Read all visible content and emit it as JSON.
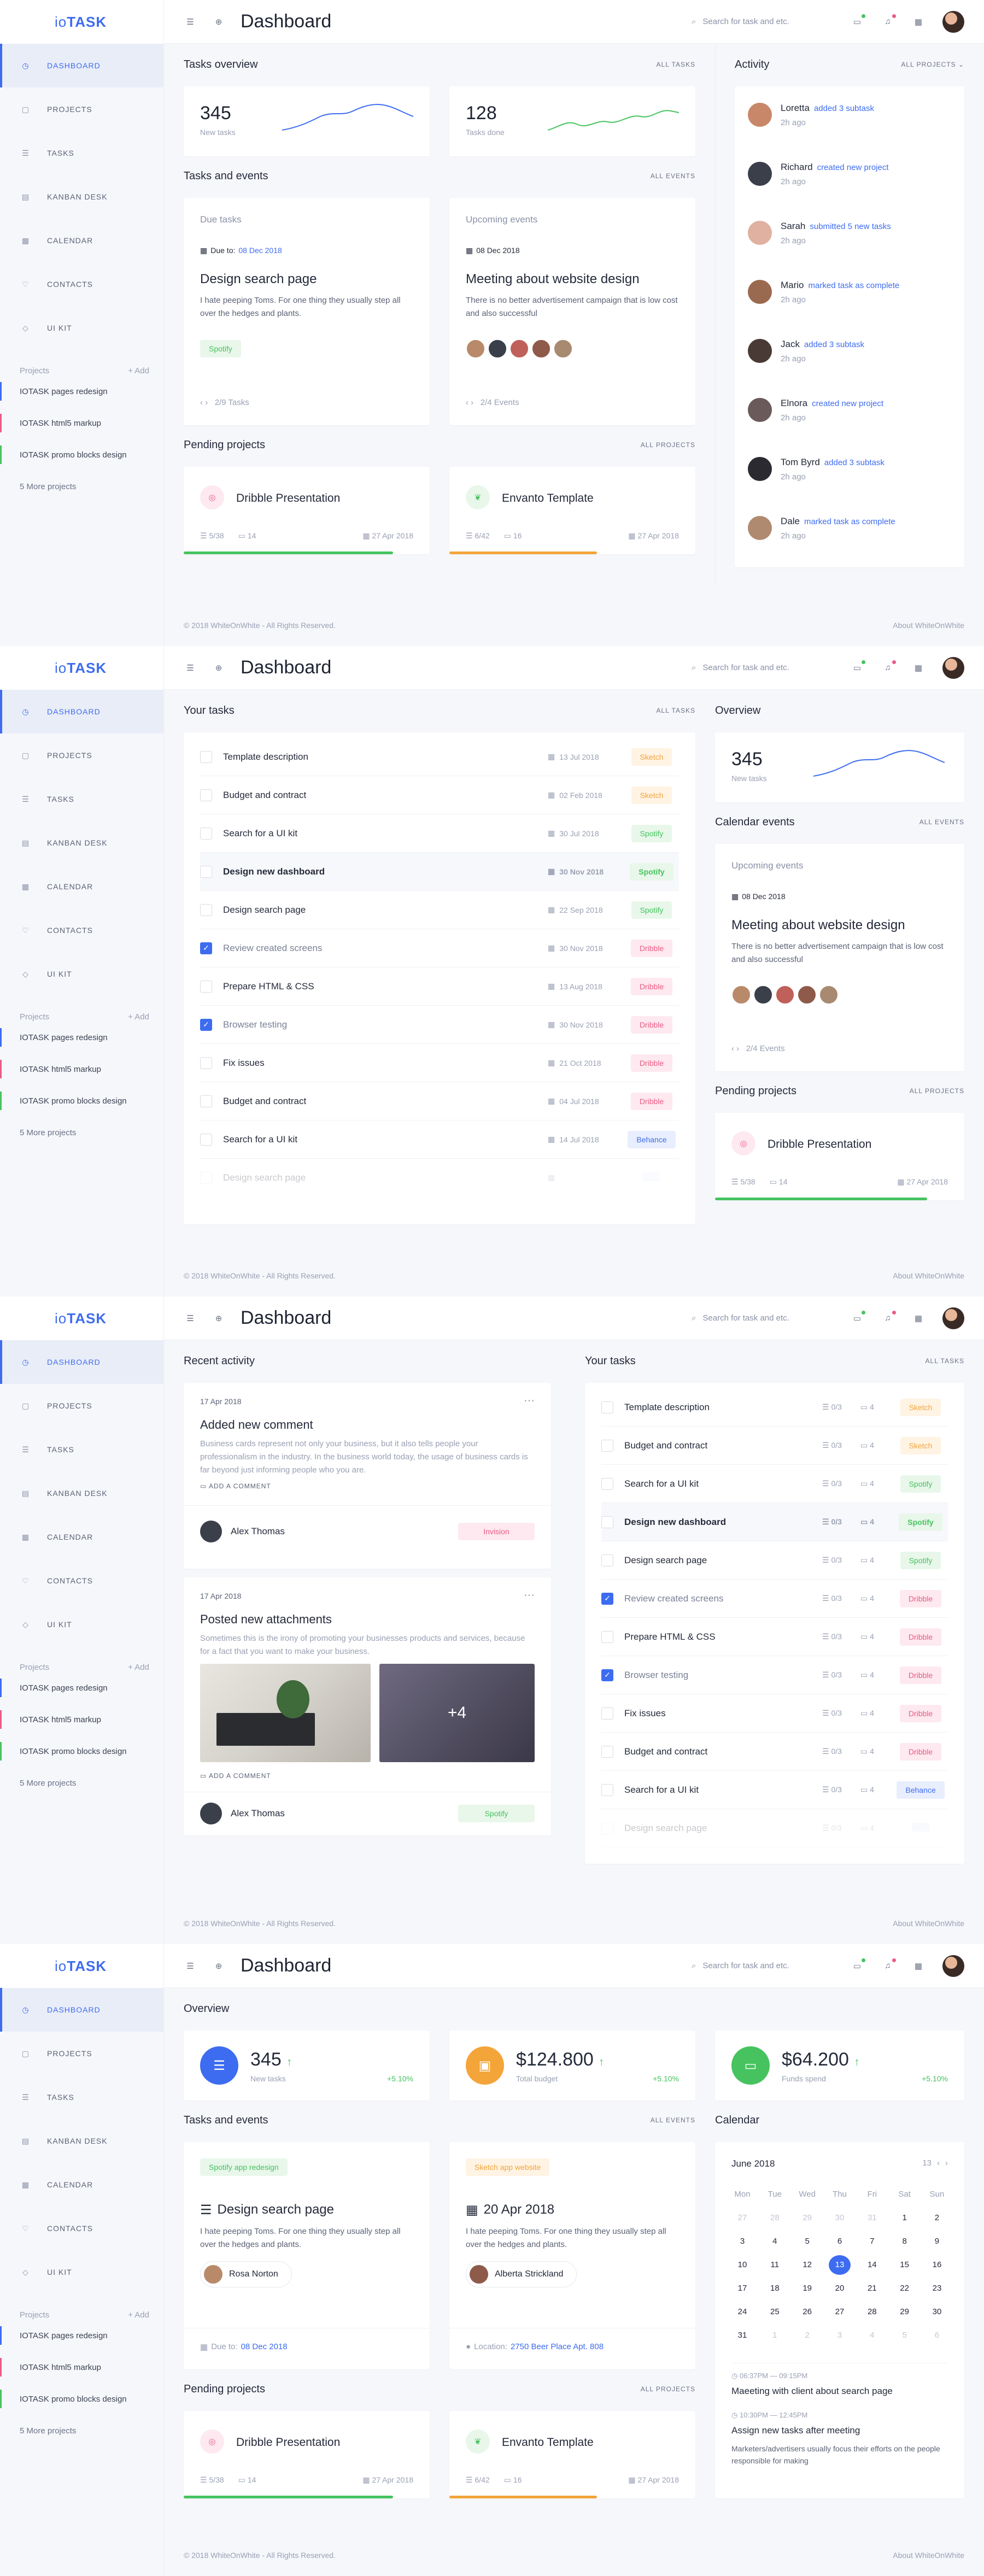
{
  "brand": {
    "prefix": "io",
    "name": "TASK"
  },
  "nav": [
    "DASHBOARD",
    "PROJECTS",
    "TASKS",
    "KANBAN DESK",
    "CALENDAR",
    "CONTACTS",
    "UI KIT"
  ],
  "projects_label": "Projects",
  "add_label": "Add",
  "projects": [
    {
      "name": "IOTASK pages redesign",
      "color": "#3d6cf0"
    },
    {
      "name": "IOTASK html5 markup",
      "color": "#ea5b86"
    },
    {
      "name": "IOTASK promo blocks design",
      "color": "#46c35f"
    }
  ],
  "more_projects": "5 More projects",
  "page_title": "Dashboard",
  "search_placeholder": "Search for task and etc.",
  "footer_left": "© 2018 WhiteOnWhite - All Rights Reserved.",
  "footer_right": "About WhiteOnWhite",
  "s1": {
    "tasks_overview": "Tasks overview",
    "all_tasks": "ALL TASKS",
    "new_tasks_num": "345",
    "new_tasks_label": "New tasks",
    "done_num": "128",
    "done_label": "Tasks done",
    "tasks_events": "Tasks and events",
    "all_events": "ALL EVENTS",
    "due_title": "Due tasks",
    "due_to": "Due to:",
    "due_date": "08 Dec 2018",
    "due_task": "Design search page",
    "due_desc": "I hate peeping Toms. For one thing they usually step all over the hedges and plants.",
    "due_tag": "Spotify",
    "due_pager": "2/9 Tasks",
    "up_title": "Upcoming events",
    "up_date": "08 Dec 2018",
    "up_event": "Meeting about website design",
    "up_desc": "There is no better advertisement campaign that is low cost and also successful",
    "up_pager": "2/4 Events",
    "pending": "Pending projects",
    "all_projects": "ALL PROJECTS",
    "p1_name": "Dribble Presentation",
    "p1_tasks": "5/38",
    "p1_comments": "14",
    "p1_date": "27 Apr 2018",
    "p1_progress": 0.85,
    "p2_name": "Envanto Template",
    "p2_tasks": "6/42",
    "p2_comments": "16",
    "p2_date": "27 Apr 2018",
    "p2_progress": 0.6,
    "activity": "Activity",
    "all_projects_dd": "ALL PROJECTS",
    "acts": [
      {
        "name": "Loretta",
        "what": "added 3 subtask",
        "time": "2h ago"
      },
      {
        "name": "Richard",
        "what": "created new project",
        "time": "2h ago"
      },
      {
        "name": "Sarah",
        "what": "submitted 5 new tasks",
        "time": "2h ago"
      },
      {
        "name": "Mario",
        "what": "marked task as complete",
        "time": "2h ago"
      },
      {
        "name": "Jack",
        "what": "added 3 subtask",
        "time": "2h ago"
      },
      {
        "name": "Elnora",
        "what": "created new project",
        "time": "2h ago"
      },
      {
        "name": "Tom Byrd",
        "what": "added 3 subtask",
        "time": "2h ago"
      },
      {
        "name": "Dale",
        "what": "marked task as complete",
        "time": "2h ago"
      }
    ]
  },
  "s2": {
    "your_tasks": "Your tasks",
    "all_tasks": "ALL TASKS",
    "tasks": [
      {
        "label": "Template description",
        "date": "13 Jul 2018",
        "tag": "Sketch",
        "t": "sk",
        "done": false
      },
      {
        "label": "Budget and contract",
        "date": "02 Feb 2018",
        "tag": "Sketch",
        "t": "sk",
        "done": false
      },
      {
        "label": "Search for a UI kit",
        "date": "30 Jul 2018",
        "tag": "Spotify",
        "t": "sp",
        "done": false
      },
      {
        "label": "Design new dashboard",
        "date": "30 Nov 2018",
        "tag": "Spotify",
        "t": "sp",
        "done": false
      },
      {
        "label": "Design search page",
        "date": "22 Sep 2018",
        "tag": "Spotify",
        "t": "sp",
        "done": false
      },
      {
        "label": "Review created screens",
        "date": "30 Nov 2018",
        "tag": "Dribble",
        "t": "dr",
        "done": true
      },
      {
        "label": "Prepare HTML & CSS",
        "date": "13 Aug 2018",
        "tag": "Dribble",
        "t": "dr",
        "done": false
      },
      {
        "label": "Browser testing",
        "date": "30 Nov 2018",
        "tag": "Dribble",
        "t": "dr",
        "done": true
      },
      {
        "label": "Fix issues",
        "date": "21 Oct 2018",
        "tag": "Dribble",
        "t": "dr",
        "done": false
      },
      {
        "label": "Budget and contract",
        "date": "04 Jul 2018",
        "tag": "Dribble",
        "t": "dr",
        "done": false
      },
      {
        "label": "Search for a UI kit",
        "date": "14 Jul 2018",
        "tag": "Behance",
        "t": "be",
        "done": false
      },
      {
        "label": "Design search page",
        "date": "",
        "tag": "",
        "t": "be",
        "done": false
      }
    ],
    "overview": "Overview",
    "new_num": "345",
    "new_label": "New tasks",
    "cal_events": "Calendar events",
    "all_events": "ALL EVENTS",
    "up_title": "Upcoming events",
    "up_date": "08 Dec 2018",
    "up_event": "Meeting about website design",
    "up_desc": "There is no better advertisement campaign that is low cost and also successful",
    "up_pager": "2/4 Events",
    "pending": "Pending projects",
    "all_projects": "ALL PROJECTS",
    "p_name": "Dribble Presentation",
    "p_tasks": "5/38",
    "p_comments": "14",
    "p_date": "27 Apr 2018",
    "p_progress": 0.85
  },
  "s3": {
    "recent": "Recent activity",
    "a1_date": "17 Apr 2018",
    "a1_title": "Added new comment",
    "a1_desc": "Business cards represent not only your business, but it also tells people your professionalism in the industry. In the business world today, the usage of business cards is far beyond just informing people who you are.",
    "add_comment": "ADD A COMMENT",
    "a1_user": "Alex Thomas",
    "a1_tag": "Invision",
    "a2_date": "17 Apr 2018",
    "a2_title": "Posted new attachments",
    "a2_desc": "Sometimes this is the irony of promoting your businesses products and services, because for a fact that you want to make your business.",
    "a2_more": "+4",
    "a2_user": "Alex Thomas",
    "a2_tag": "Spotify",
    "your_tasks": "Your tasks",
    "all_tasks": "ALL TASKS",
    "tasks": [
      {
        "label": "Template description",
        "tag": "Sketch",
        "t": "sk",
        "done": false
      },
      {
        "label": "Budget and contract",
        "tag": "Sketch",
        "t": "sk",
        "done": false
      },
      {
        "label": "Search for a UI kit",
        "tag": "Spotify",
        "t": "sp",
        "done": false
      },
      {
        "label": "Design new dashboard",
        "tag": "Spotify",
        "t": "sp",
        "done": false
      },
      {
        "label": "Design search page",
        "tag": "Spotify",
        "t": "sp",
        "done": false
      },
      {
        "label": "Review created screens",
        "tag": "Dribble",
        "t": "dr",
        "done": true
      },
      {
        "label": "Prepare HTML & CSS",
        "tag": "Dribble",
        "t": "dr",
        "done": false
      },
      {
        "label": "Browser testing",
        "tag": "Dribble",
        "t": "dr",
        "done": true
      },
      {
        "label": "Fix issues",
        "tag": "Dribble",
        "t": "dr",
        "done": false
      },
      {
        "label": "Budget and contract",
        "tag": "Dribble",
        "t": "dr",
        "done": false
      },
      {
        "label": "Search for a UI kit",
        "tag": "Behance",
        "t": "be",
        "done": false
      },
      {
        "label": "Design search page",
        "tag": "",
        "t": "be",
        "done": false
      }
    ],
    "subtasks": "0/3",
    "comments": "4"
  },
  "s4": {
    "overview": "Overview",
    "st1_num": "345",
    "st1_label": "New tasks",
    "st1_pct": "+5.10%",
    "st2_num": "$124.800",
    "st2_label": "Total budget",
    "st2_pct": "+5.10%",
    "st3_num": "$64.200",
    "st3_label": "Funds spend",
    "st3_pct": "+5.10%",
    "tasks_events": "Tasks and events",
    "all_events": "ALL EVENTS",
    "c1_tag": "Spotify app redesign",
    "c1_task": "Design search page",
    "c1_desc": "I hate peeping Toms. For one thing they usually step all over the hedges and plants.",
    "c1_user": "Rosa Norton",
    "due_to": "Due to:",
    "c1_date": "08 Dec 2018",
    "c2_tag": "Sketch app website",
    "c2_date": "20 Apr 2018",
    "c2_desc": "I hate peeping Toms. For one thing they usually step all over the hedges and plants.",
    "c2_user": "Alberta Strickland",
    "loc_label": "Location:",
    "c2_loc": "2750 Beer Place Apt. 808",
    "calendar": "Calendar",
    "month": "June 2018",
    "today_num": "13",
    "days": [
      "Mon",
      "Tue",
      "Wed",
      "Thu",
      "Fri",
      "Sat",
      "Sun"
    ],
    "weeks": [
      [
        "27",
        "28",
        "29",
        "30",
        "31",
        "1",
        "2"
      ],
      [
        "3",
        "4",
        "5",
        "6",
        "7",
        "8",
        "9"
      ],
      [
        "10",
        "11",
        "12",
        "13",
        "14",
        "15",
        "16"
      ],
      [
        "17",
        "18",
        "19",
        "20",
        "21",
        "22",
        "23"
      ],
      [
        "24",
        "25",
        "26",
        "27",
        "28",
        "29",
        "30"
      ],
      [
        "31",
        "1",
        "2",
        "3",
        "4",
        "5",
        "6"
      ]
    ],
    "ev1_time": "06:37PM — 09:15PM",
    "ev1_title": "Maeeting with client about search page",
    "ev2_time": "10:30PM — 12:45PM",
    "ev2_title": "Assign new tasks after meeting",
    "ev2_desc": "Marketers/advertisers usually focus their efforts on the people responsible for making",
    "pending": "Pending projects",
    "all_projects": "ALL PROJECTS",
    "p1_name": "Dribble Presentation",
    "p1_tasks": "5/38",
    "p1_comments": "14",
    "p1_date": "27 Apr 2018",
    "p1_progress": 0.85,
    "p2_name": "Envanto Template",
    "p2_tasks": "6/42",
    "p2_comments": "16",
    "p2_date": "27 Apr 2018",
    "p2_progress": 0.6
  },
  "colors": {
    "accent": "#3d6cf0",
    "green": "#46c35f",
    "orange": "#f3a53a",
    "pink": "#ea5b86"
  }
}
